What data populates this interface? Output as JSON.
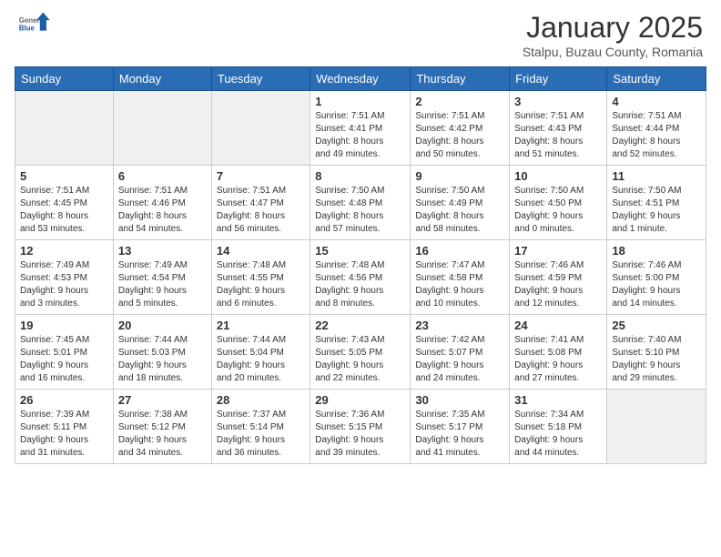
{
  "logo": {
    "general": "General",
    "blue": "Blue"
  },
  "title": "January 2025",
  "subtitle": "Stalpu, Buzau County, Romania",
  "days_of_week": [
    "Sunday",
    "Monday",
    "Tuesday",
    "Wednesday",
    "Thursday",
    "Friday",
    "Saturday"
  ],
  "weeks": [
    [
      {
        "day": "",
        "empty": true
      },
      {
        "day": "",
        "empty": true
      },
      {
        "day": "",
        "empty": true
      },
      {
        "day": "1",
        "info": "Sunrise: 7:51 AM\nSunset: 4:41 PM\nDaylight: 8 hours\nand 49 minutes."
      },
      {
        "day": "2",
        "info": "Sunrise: 7:51 AM\nSunset: 4:42 PM\nDaylight: 8 hours\nand 50 minutes."
      },
      {
        "day": "3",
        "info": "Sunrise: 7:51 AM\nSunset: 4:43 PM\nDaylight: 8 hours\nand 51 minutes."
      },
      {
        "day": "4",
        "info": "Sunrise: 7:51 AM\nSunset: 4:44 PM\nDaylight: 8 hours\nand 52 minutes."
      }
    ],
    [
      {
        "day": "5",
        "info": "Sunrise: 7:51 AM\nSunset: 4:45 PM\nDaylight: 8 hours\nand 53 minutes."
      },
      {
        "day": "6",
        "info": "Sunrise: 7:51 AM\nSunset: 4:46 PM\nDaylight: 8 hours\nand 54 minutes."
      },
      {
        "day": "7",
        "info": "Sunrise: 7:51 AM\nSunset: 4:47 PM\nDaylight: 8 hours\nand 56 minutes."
      },
      {
        "day": "8",
        "info": "Sunrise: 7:50 AM\nSunset: 4:48 PM\nDaylight: 8 hours\nand 57 minutes."
      },
      {
        "day": "9",
        "info": "Sunrise: 7:50 AM\nSunset: 4:49 PM\nDaylight: 8 hours\nand 58 minutes."
      },
      {
        "day": "10",
        "info": "Sunrise: 7:50 AM\nSunset: 4:50 PM\nDaylight: 9 hours\nand 0 minutes."
      },
      {
        "day": "11",
        "info": "Sunrise: 7:50 AM\nSunset: 4:51 PM\nDaylight: 9 hours\nand 1 minute."
      }
    ],
    [
      {
        "day": "12",
        "info": "Sunrise: 7:49 AM\nSunset: 4:53 PM\nDaylight: 9 hours\nand 3 minutes."
      },
      {
        "day": "13",
        "info": "Sunrise: 7:49 AM\nSunset: 4:54 PM\nDaylight: 9 hours\nand 5 minutes."
      },
      {
        "day": "14",
        "info": "Sunrise: 7:48 AM\nSunset: 4:55 PM\nDaylight: 9 hours\nand 6 minutes."
      },
      {
        "day": "15",
        "info": "Sunrise: 7:48 AM\nSunset: 4:56 PM\nDaylight: 9 hours\nand 8 minutes."
      },
      {
        "day": "16",
        "info": "Sunrise: 7:47 AM\nSunset: 4:58 PM\nDaylight: 9 hours\nand 10 minutes."
      },
      {
        "day": "17",
        "info": "Sunrise: 7:46 AM\nSunset: 4:59 PM\nDaylight: 9 hours\nand 12 minutes."
      },
      {
        "day": "18",
        "info": "Sunrise: 7:46 AM\nSunset: 5:00 PM\nDaylight: 9 hours\nand 14 minutes."
      }
    ],
    [
      {
        "day": "19",
        "info": "Sunrise: 7:45 AM\nSunset: 5:01 PM\nDaylight: 9 hours\nand 16 minutes."
      },
      {
        "day": "20",
        "info": "Sunrise: 7:44 AM\nSunset: 5:03 PM\nDaylight: 9 hours\nand 18 minutes."
      },
      {
        "day": "21",
        "info": "Sunrise: 7:44 AM\nSunset: 5:04 PM\nDaylight: 9 hours\nand 20 minutes."
      },
      {
        "day": "22",
        "info": "Sunrise: 7:43 AM\nSunset: 5:05 PM\nDaylight: 9 hours\nand 22 minutes."
      },
      {
        "day": "23",
        "info": "Sunrise: 7:42 AM\nSunset: 5:07 PM\nDaylight: 9 hours\nand 24 minutes."
      },
      {
        "day": "24",
        "info": "Sunrise: 7:41 AM\nSunset: 5:08 PM\nDaylight: 9 hours\nand 27 minutes."
      },
      {
        "day": "25",
        "info": "Sunrise: 7:40 AM\nSunset: 5:10 PM\nDaylight: 9 hours\nand 29 minutes."
      }
    ],
    [
      {
        "day": "26",
        "info": "Sunrise: 7:39 AM\nSunset: 5:11 PM\nDaylight: 9 hours\nand 31 minutes."
      },
      {
        "day": "27",
        "info": "Sunrise: 7:38 AM\nSunset: 5:12 PM\nDaylight: 9 hours\nand 34 minutes."
      },
      {
        "day": "28",
        "info": "Sunrise: 7:37 AM\nSunset: 5:14 PM\nDaylight: 9 hours\nand 36 minutes."
      },
      {
        "day": "29",
        "info": "Sunrise: 7:36 AM\nSunset: 5:15 PM\nDaylight: 9 hours\nand 39 minutes."
      },
      {
        "day": "30",
        "info": "Sunrise: 7:35 AM\nSunset: 5:17 PM\nDaylight: 9 hours\nand 41 minutes."
      },
      {
        "day": "31",
        "info": "Sunrise: 7:34 AM\nSunset: 5:18 PM\nDaylight: 9 hours\nand 44 minutes."
      },
      {
        "day": "",
        "empty": true
      }
    ]
  ]
}
